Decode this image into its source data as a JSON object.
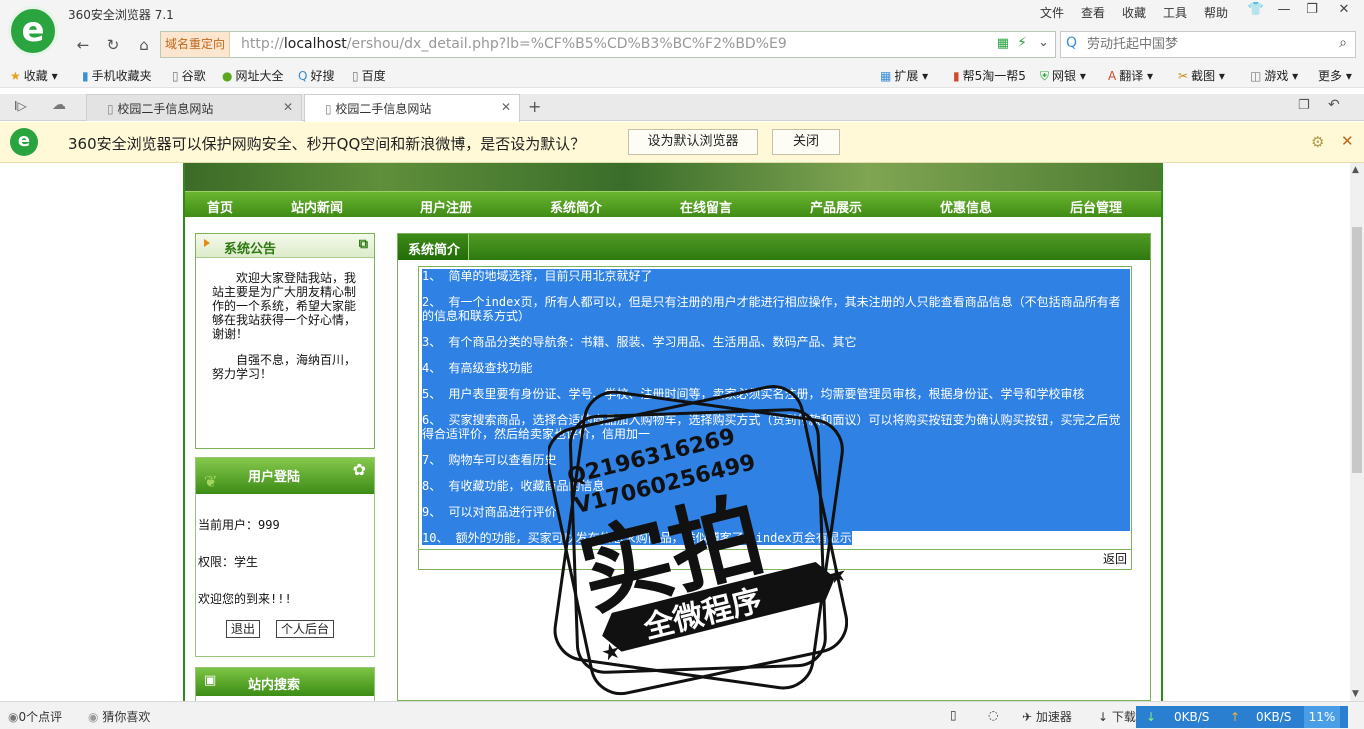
{
  "browser": {
    "title": "360安全浏览器 7.1",
    "menus": [
      "文件",
      "查看",
      "收藏",
      "工具",
      "帮助"
    ],
    "redirect_label": "域名重定向",
    "url_prefix": "http://",
    "url_host": "localhost",
    "url_path": "/ershou/dx_detail.php?lb=%CF%B5%CD%B3%BC%F2%BD%E9",
    "search_placeholder": "劳动托起中国梦"
  },
  "bookmarks": [
    "收藏",
    "手机收藏夹",
    "谷歌",
    "网址大全",
    "好搜",
    "百度",
    "扩展",
    "帮5淘一帮5",
    "网银",
    "翻译",
    "截图",
    "游戏",
    "更多"
  ],
  "tabs": [
    {
      "title": "校园二手信息网站"
    },
    {
      "title": "校园二手信息网站"
    }
  ],
  "notice": {
    "text": "360安全浏览器可以保护网购安全、秒开QQ空间和新浪微博，是否设为默认？",
    "set_default": "设为默认浏览器",
    "close": "关闭"
  },
  "site": {
    "nav": [
      "首页",
      "站内新闻",
      "用户注册",
      "系统简介",
      "在线留言",
      "产品展示",
      "优惠信息",
      "后台管理"
    ],
    "announce": {
      "title": "系统公告",
      "p1": "欢迎大家登陆我站，我站主要是为广大朋友精心制作的一个系统，希望大家能够在我站获得一个好心情，谢谢！",
      "p2": "自强不息，海纳百川，努力学习！"
    },
    "login": {
      "title": "用户登陆",
      "user": "当前用户：999",
      "role": "权限：学生",
      "welcome": "欢迎您的到来!!!",
      "logout": "退出",
      "admin": "个人后台"
    },
    "search": {
      "title": "站内搜索"
    },
    "main": {
      "title": "系统简介",
      "back": "返回",
      "lines": [
        "1、 简单的地域选择，目前只用北京就好了",
        "2、 有一个index页，所有人都可以，但是只有注册的用户才能进行相应操作，其未注册的人只能查看商品信息（不包括商品所有者的信息和联系方式）",
        "3、 有个商品分类的导航条：书籍、服装、学习用品、生活用品、数码产品、其它",
        "4、 有高级查找功能",
        "5、 用户表里要有身份证、学号、学校、注册时间等，卖家必须实名注册，均需要管理员审核，根据身份证、学号和学校审核",
        "6、 买家搜索商品，选择合适的商品加入购物车，选择购买方式（货到付款和面议）可以将购买按钮变为确认购买按钮，买完之后觉得合适评价，然后给卖家也评价，信用加一",
        "7、 购物车可以查看历史",
        "8、 有收藏功能，收藏商品的信息",
        "9、 可以对商品进行评价",
        "10、 额外的功能，买家可以发布信息求购商品，类似博客了，index页会有显示"
      ]
    }
  },
  "stamp": {
    "qq": "Q2196316269",
    "v": "V17060256499",
    "big": "实拍",
    "banner": "全微程序"
  },
  "status": {
    "comments": "0个点评",
    "guess": "猜你喜欢",
    "accel": "加速器",
    "download": "下载",
    "down_speed": "0KB/S",
    "up_speed": "0KB/S",
    "cpu": "11%"
  },
  "colors": {
    "selection": "#2f81e4",
    "nav_green": "#3f8c16",
    "brand_green": "#2aa43f"
  }
}
